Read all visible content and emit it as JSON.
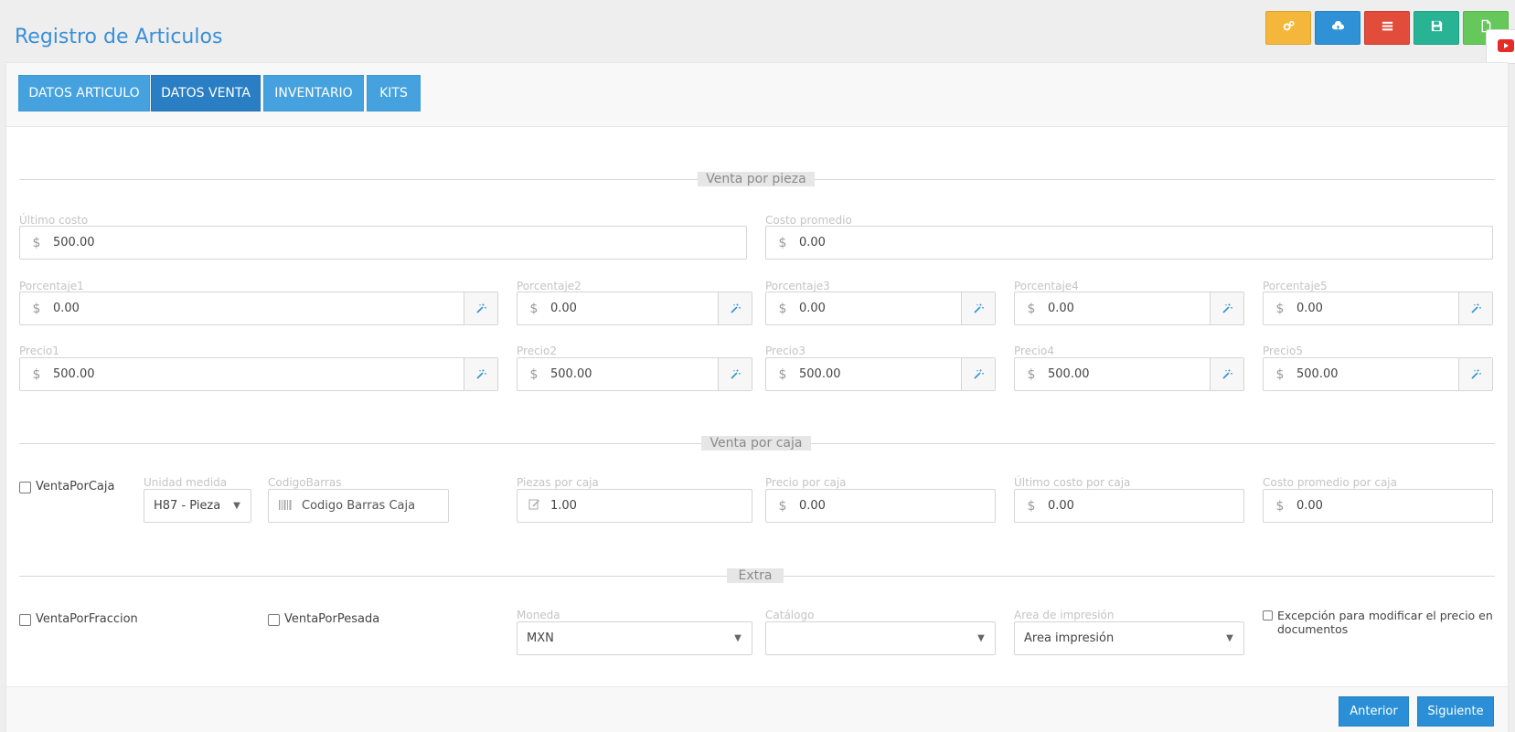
{
  "page": {
    "title": "Registro de Articulos"
  },
  "toolbar": {
    "buttons": [
      {
        "icon": "gears-icon",
        "color": "#f4b63b"
      },
      {
        "icon": "cloud-upload-icon",
        "color": "#2f92d6"
      },
      {
        "icon": "list-icon",
        "color": "#e24d3b"
      },
      {
        "icon": "save-icon",
        "color": "#27b394"
      },
      {
        "icon": "new-document-icon",
        "color": "#66c85a"
      }
    ]
  },
  "tabs": [
    {
      "label": "DATOS ARTICULO",
      "active": false
    },
    {
      "label": "DATOS VENTA",
      "active": true
    },
    {
      "label": "INVENTARIO",
      "active": false
    },
    {
      "label": "KITS",
      "active": false
    }
  ],
  "sections": {
    "pieza": "Venta por pieza",
    "caja": "Venta por caja",
    "extra": "Extra"
  },
  "pieza": {
    "ultimo_costo": {
      "label": "Último costo",
      "prefix": "$",
      "value": "500.00"
    },
    "costo_promedio": {
      "label": "Costo promedio",
      "prefix": "$",
      "value": "0.00"
    },
    "porcentajes": [
      {
        "label": "Porcentaje1",
        "prefix": "$",
        "value": "0.00"
      },
      {
        "label": "Porcentaje2",
        "prefix": "$",
        "value": "0.00"
      },
      {
        "label": "Porcentaje3",
        "prefix": "$",
        "value": "0.00"
      },
      {
        "label": "Porcentaje4",
        "prefix": "$",
        "value": "0.00"
      },
      {
        "label": "Porcentaje5",
        "prefix": "$",
        "value": "0.00"
      }
    ],
    "precios": [
      {
        "label": "Precio1",
        "prefix": "$",
        "value": "500.00"
      },
      {
        "label": "Precio2",
        "prefix": "$",
        "value": "500.00"
      },
      {
        "label": "Precio3",
        "prefix": "$",
        "value": "500.00"
      },
      {
        "label": "Precio4",
        "prefix": "$",
        "value": "500.00"
      },
      {
        "label": "Precio5",
        "prefix": "$",
        "value": "500.00"
      }
    ]
  },
  "caja": {
    "venta_por_caja": {
      "label": "VentaPorCaja",
      "checked": false
    },
    "unidad_medida": {
      "label": "Unidad medida",
      "value": "H87 - Pieza"
    },
    "codigo_barras": {
      "label": "CodigoBarras",
      "placeholder": "Codigo Barras Caja"
    },
    "piezas_por_caja": {
      "label": "Piezas por caja",
      "value": "1.00"
    },
    "precio_por_caja": {
      "label": "Precio por caja",
      "prefix": "$",
      "value": "0.00"
    },
    "ultimo_costo_caja": {
      "label": "Último costo por caja",
      "prefix": "$",
      "value": "0.00"
    },
    "costo_promedio_caja": {
      "label": "Costo promedio por caja",
      "prefix": "$",
      "value": "0.00"
    }
  },
  "extra": {
    "venta_por_fraccion": {
      "label": "VentaPorFraccion",
      "checked": false
    },
    "venta_por_pesada": {
      "label": "VentaPorPesada",
      "checked": false
    },
    "moneda": {
      "label": "Moneda",
      "value": "MXN"
    },
    "catalogo": {
      "label": "Catálogo",
      "value": ""
    },
    "area_impresion": {
      "label": "Area de impresión",
      "value": "Area impresión"
    },
    "excepcion": {
      "label": "Excepción para modificar el precio en documentos",
      "checked": false
    }
  },
  "footer": {
    "anterior": "Anterior",
    "siguiente": "Siguiente"
  }
}
